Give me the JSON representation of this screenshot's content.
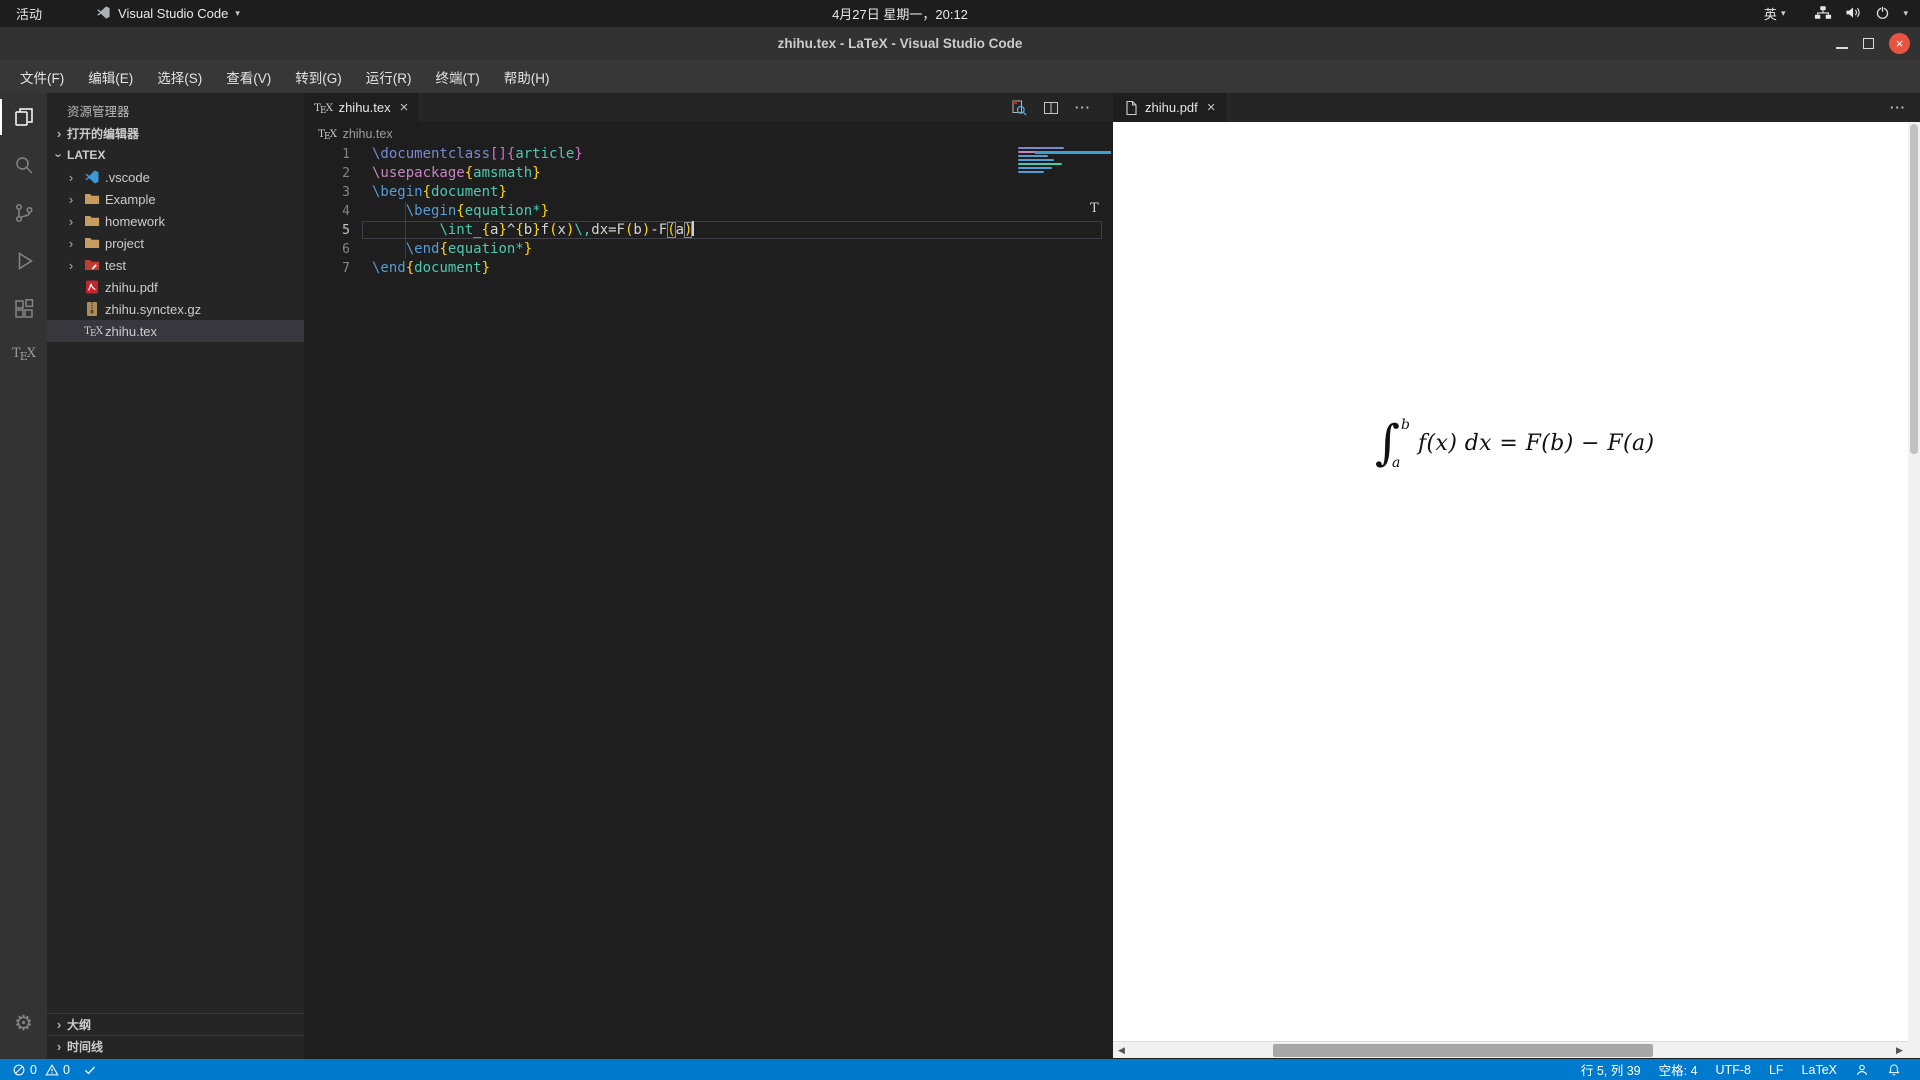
{
  "desktop_bar": {
    "activities": "活动",
    "app_name": "Visual Studio Code",
    "clock": "4月27日 星期一，20:12",
    "input_method": "英",
    "right_icons": [
      "input-method",
      "network-icon",
      "volume-icon",
      "power-icon"
    ]
  },
  "title_bar": {
    "title": "zhihu.tex - LaTeX - Visual Studio Code",
    "controls": [
      "minimize",
      "restore",
      "close"
    ]
  },
  "menu_bar": {
    "items": [
      "文件(F)",
      "编辑(E)",
      "选择(S)",
      "查看(V)",
      "转到(G)",
      "运行(R)",
      "终端(T)",
      "帮助(H)"
    ]
  },
  "activity_bar": {
    "icons": [
      "explorer",
      "search",
      "source-control",
      "run-debug",
      "extensions",
      "latex-workshop"
    ],
    "latex_workshop_label": "TEX",
    "bottom_icons": [
      "settings"
    ]
  },
  "sidebar": {
    "title": "资源管理器",
    "open_editors_label": "打开的编辑器",
    "root_label": "LATEX",
    "files": [
      {
        "name": ".vscode",
        "icon": "vscode-folder",
        "chevron": true
      },
      {
        "name": "Example",
        "icon": "folder",
        "chevron": true
      },
      {
        "name": "homework",
        "icon": "folder",
        "chevron": true
      },
      {
        "name": "project",
        "icon": "folder",
        "chevron": true
      },
      {
        "name": "test",
        "icon": "test-folder",
        "chevron": true
      },
      {
        "name": "zhihu.pdf",
        "icon": "pdf-file",
        "chevron": false
      },
      {
        "name": "zhihu.synctex.gz",
        "icon": "archive-file",
        "chevron": false
      },
      {
        "name": "zhihu.tex",
        "icon": "tex-file",
        "chevron": false,
        "selected": true
      }
    ],
    "bottom_sections": [
      "大纲",
      "时间线"
    ]
  },
  "editor": {
    "tab": {
      "label": "zhihu.tex"
    },
    "breadcrumb": "zhihu.tex",
    "actions": [
      "view-latex-pdf",
      "split-editor",
      "more-actions"
    ],
    "current_line": 5,
    "overview_mark": "T",
    "lines": [
      {
        "num": 1,
        "tokens": [
          {
            "t": "\\documentclass",
            "c": "violet"
          },
          {
            "t": "[]",
            "c": "magenta"
          },
          {
            "t": "{",
            "c": "magenta"
          },
          {
            "t": "article",
            "c": "env"
          },
          {
            "t": "}",
            "c": "magenta"
          }
        ]
      },
      {
        "num": 2,
        "tokens": [
          {
            "t": "\\usepackage",
            "c": "pink"
          },
          {
            "t": "{",
            "c": "gold"
          },
          {
            "t": "amsmath",
            "c": "env"
          },
          {
            "t": "}",
            "c": "gold"
          }
        ]
      },
      {
        "num": 3,
        "tokens": [
          {
            "t": "\\begin",
            "c": "blue"
          },
          {
            "t": "{",
            "c": "gold"
          },
          {
            "t": "document",
            "c": "env"
          },
          {
            "t": "}",
            "c": "gold"
          }
        ]
      },
      {
        "num": 4,
        "tokens": [
          {
            "t": "    ",
            "c": "text"
          },
          {
            "t": "\\begin",
            "c": "blue"
          },
          {
            "t": "{",
            "c": "gold"
          },
          {
            "t": "equation*",
            "c": "env"
          },
          {
            "t": "}",
            "c": "gold"
          }
        ]
      },
      {
        "num": 5,
        "tokens": [
          {
            "t": "        ",
            "c": "text"
          },
          {
            "t": "\\int",
            "c": "teal"
          },
          {
            "t": "_",
            "c": "text"
          },
          {
            "t": "{",
            "c": "gold"
          },
          {
            "t": "a",
            "c": "text"
          },
          {
            "t": "}",
            "c": "gold"
          },
          {
            "t": "^",
            "c": "text"
          },
          {
            "t": "{",
            "c": "gold"
          },
          {
            "t": "b",
            "c": "text"
          },
          {
            "t": "}",
            "c": "gold"
          },
          {
            "t": "f",
            "c": "text"
          },
          {
            "t": "(",
            "c": "gold"
          },
          {
            "t": "x",
            "c": "text"
          },
          {
            "t": ")",
            "c": "gold"
          },
          {
            "t": "\\,",
            "c": "teal"
          },
          {
            "t": "dx=F",
            "c": "text"
          },
          {
            "t": "(",
            "c": "gold"
          },
          {
            "t": "b",
            "c": "text"
          },
          {
            "t": ")",
            "c": "gold"
          },
          {
            "t": "-F",
            "c": "text"
          },
          {
            "t": "(",
            "c": "gold",
            "box": true
          },
          {
            "t": "a",
            "c": "text"
          },
          {
            "t": ")",
            "c": "gold",
            "box": true
          },
          {
            "cursor": true
          }
        ]
      },
      {
        "num": 6,
        "tokens": [
          {
            "t": "    ",
            "c": "text"
          },
          {
            "t": "\\end",
            "c": "blue"
          },
          {
            "t": "{",
            "c": "gold"
          },
          {
            "t": "equation*",
            "c": "env"
          },
          {
            "t": "}",
            "c": "gold"
          }
        ]
      },
      {
        "num": 7,
        "tokens": [
          {
            "t": "\\end",
            "c": "blue"
          },
          {
            "t": "{",
            "c": "gold"
          },
          {
            "t": "document",
            "c": "env"
          },
          {
            "t": "}",
            "c": "gold"
          }
        ]
      }
    ]
  },
  "pdf_pane": {
    "tab": {
      "label": "zhihu.pdf"
    },
    "formula": {
      "integral": "∫",
      "upper": "b",
      "lower": "a",
      "body": "f(x) dx = F(b) − F(a)"
    }
  },
  "status_bar": {
    "errors": "0",
    "warnings": "0",
    "left_icons": [
      "error-count",
      "warning-count",
      "build-check"
    ],
    "line_col": "行 5, 列 39",
    "indent": "空格: 4",
    "encoding": "UTF-8",
    "eol": "LF",
    "language": "LaTeX",
    "right_icons": [
      "feedback-person",
      "notifications-bell"
    ]
  },
  "colors": {
    "status_bar": "#007acc",
    "activity_bar": "#333333",
    "sidebar": "#252526",
    "editor_bg": "#1e1e1e",
    "close_button": "#e6553f",
    "token_blue": "#569cd6",
    "token_pink": "#c586c0",
    "token_env_teal": "#4ec9b0",
    "token_gold": "#ffd700",
    "token_magenta": "#d670d6",
    "token_violet": "#7b88cf",
    "token_text": "#d4d4d4"
  }
}
